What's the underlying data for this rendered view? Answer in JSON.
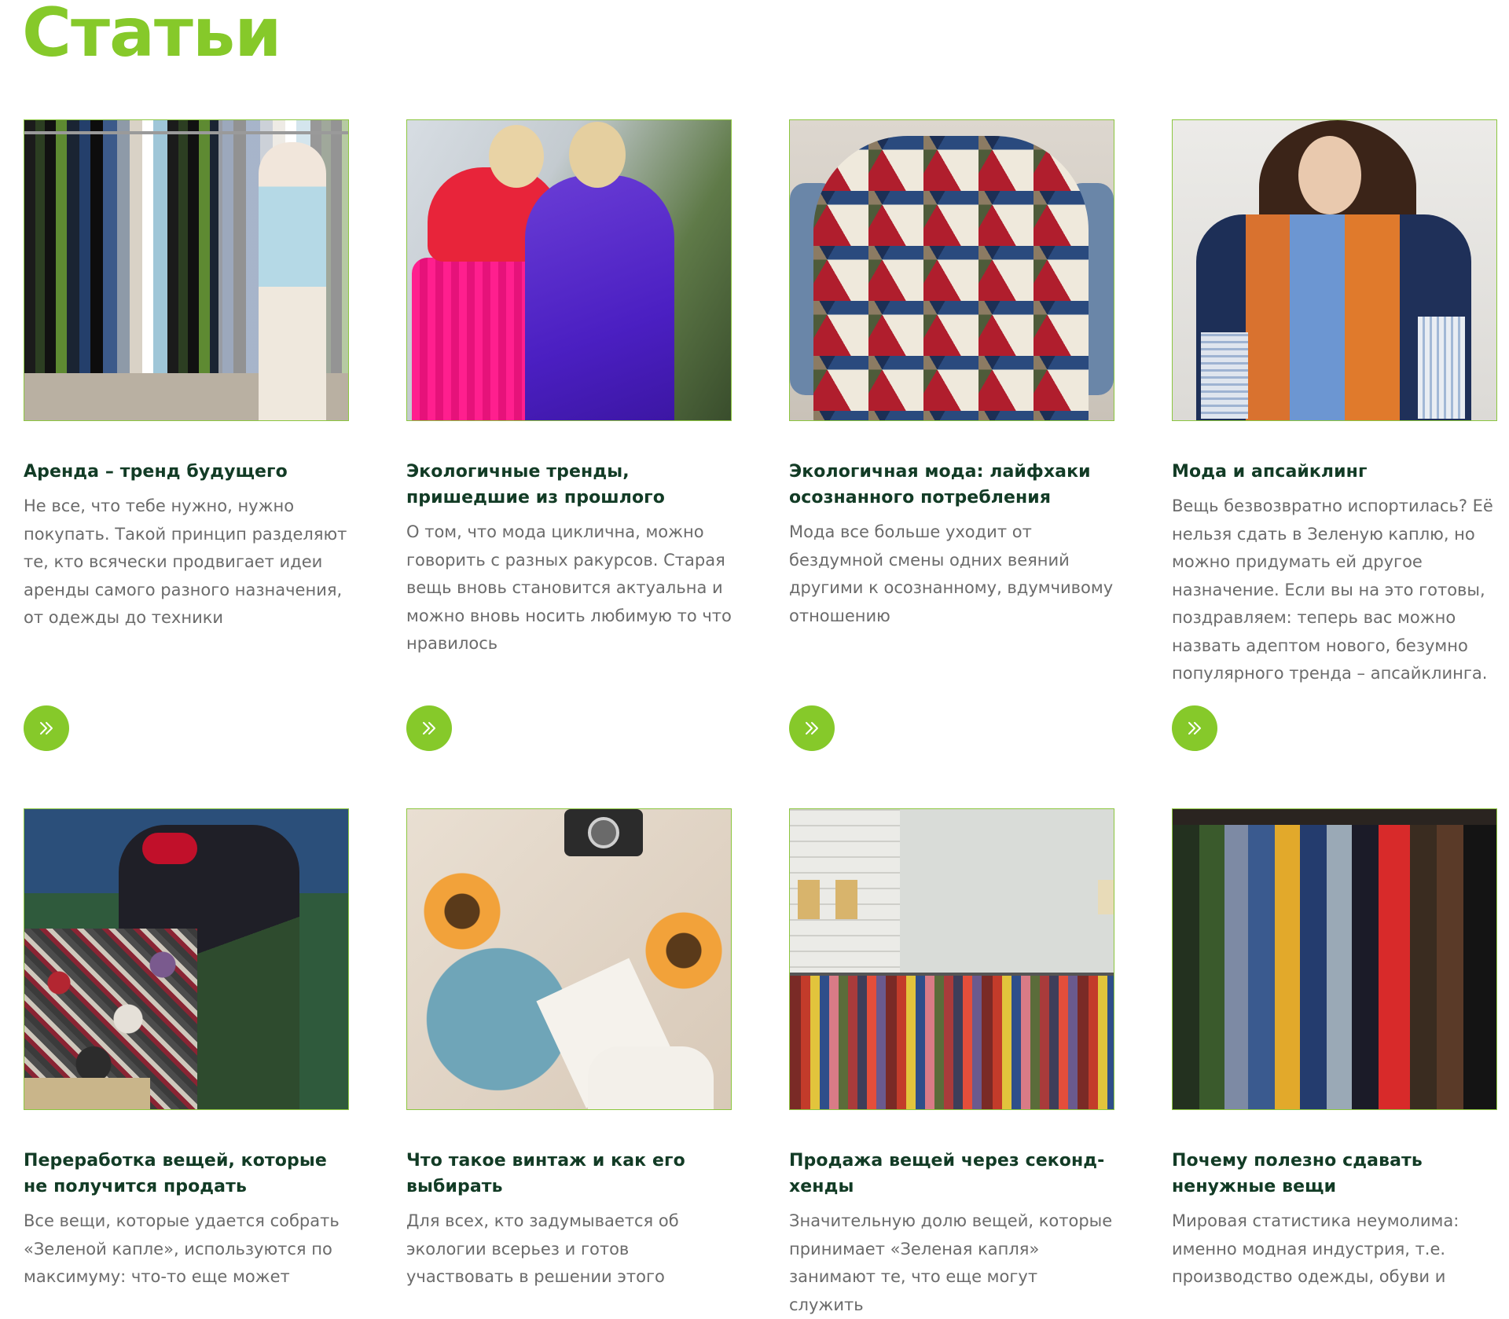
{
  "page": {
    "title": "Статьи"
  },
  "colors": {
    "accent": "#86c92a",
    "title_text": "#123b25",
    "body_text": "#6b6b6b",
    "image_border": "#8cc63f"
  },
  "articles": [
    {
      "title": "Аренда – тренд будущего",
      "excerpt": "Не все, что тебе нужно, нужно покупать. Такой принцип разделяют те, кто всячески продвигает идеи аренды самого разного назначения, от одежды до техники",
      "image": "clothing-rental-rack-photo",
      "button_icon": "double-chevron-right-icon"
    },
    {
      "title": "Экологичные тренды, пришедшие из прошлого",
      "excerpt": "О том, что мода циклична, можно говорить с разных ракурсов. Старая вещь вновь становится актуальна и можно вновь носить любимую то что нравилось",
      "image": "two-women-street-fashion-photo",
      "button_icon": "double-chevron-right-icon"
    },
    {
      "title": "Экологичная мода: лайфхаки осознанного потребления",
      "excerpt": "Мода все больше уходит от бездумной смены одних веяний другими к осознанному, вдумчивому отношению",
      "image": "patchwork-shirt-back-photo",
      "button_icon": "double-chevron-right-icon"
    },
    {
      "title": "Мода и апсайклинг",
      "excerpt": "Вещь безвозвратно испортилась? Её нельзя сдать в Зеленую каплю, но можно придумать ей другое назначение. Если вы на это готовы, поздравляем: теперь вас можно назвать адептом нового, безумно популярного тренда – апсайклинга.",
      "image": "upcycled-patchwork-shirt-model-photo",
      "button_icon": "double-chevron-right-icon"
    },
    {
      "title": "Переработка вещей, которые не получится продать",
      "excerpt": "Все вещи, которые удается собрать «Зеленой капле», используются по максимуму: что-то еще может",
      "image": "textile-recycling-worker-photo",
      "button_icon": "double-chevron-right-icon"
    },
    {
      "title": "Что такое винтаж и как его выбирать",
      "excerpt": "Для всех, кто задумывается об экологии всерьез и готов участвовать в решении этого",
      "image": "vintage-flatlay-photo",
      "button_icon": "double-chevron-right-icon"
    },
    {
      "title": "Продажа вещей через секонд-хенды",
      "excerpt": "Значительную долю вещей, которые принимает «Зеленая капля» занимают те, что еще могут служить",
      "image": "second-hand-store-rack-photo",
      "button_icon": "double-chevron-right-icon"
    },
    {
      "title": "Почему полезно сдавать ненужные вещи",
      "excerpt": "Мировая статистика неумолима: именно модная индустрия, т.е. производство одежды, обуви и",
      "image": "colorful-clothes-hanging-photo",
      "button_icon": "double-chevron-right-icon"
    }
  ]
}
